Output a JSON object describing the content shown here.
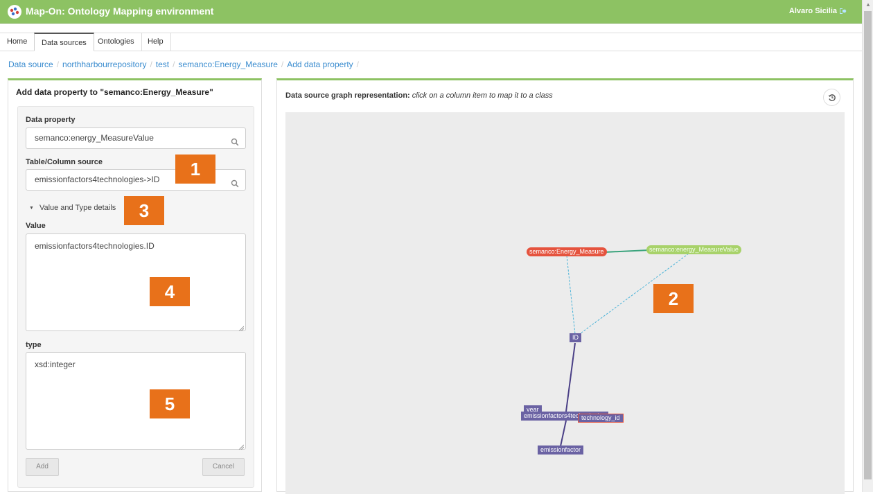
{
  "header": {
    "app_title": "Map-On: Ontology Mapping environment",
    "user_name": "Alvaro Sicilia",
    "logo_icon": "mapon-logo-icon",
    "logout_icon": "logout-icon",
    "bar_color": "#8dc263"
  },
  "nav": {
    "tabs": [
      {
        "label": "Home",
        "active": false
      },
      {
        "label": "Data sources",
        "active": true
      },
      {
        "label": "Ontologies",
        "active": false
      },
      {
        "label": "Help",
        "active": false
      }
    ]
  },
  "breadcrumb": [
    "Data source",
    "northharbourrepository",
    "test",
    "semanco:Energy_Measure",
    "Add data property"
  ],
  "form": {
    "heading": "Add data property to \"semanco:Energy_Measure\"",
    "data_property_label": "Data property",
    "data_property_value": "semanco:energy_MeasureValue",
    "source_label": "Table/Column source",
    "source_value": "emissionfactors4technologies->ID",
    "details_toggle": "Value and Type details",
    "value_label": "Value",
    "value_text": "emissionfactors4technologies.ID",
    "type_label": "type",
    "type_text": "xsd:integer",
    "add_button": "Add",
    "cancel_button": "Cancel"
  },
  "graph": {
    "title_bold": "Data source graph representation:",
    "title_hint": "click on a column item to map it to a class",
    "reset_icon": "history-reset-icon",
    "nodes": {
      "class_node": "semanco:Energy_Measure",
      "property_node": "semanco:energy_MeasureValue",
      "id_node": "ID",
      "year_node": "year",
      "table_node": "emissionfactors4technologies",
      "technology_node": "technology_id",
      "emission_node": "emissionfactor"
    },
    "colors": {
      "class": "#e5533e",
      "property": "#a8d26a",
      "column": "#6a62a3",
      "link": "#4ab3d8"
    }
  },
  "markers": [
    "1",
    "2",
    "3",
    "4",
    "5"
  ]
}
